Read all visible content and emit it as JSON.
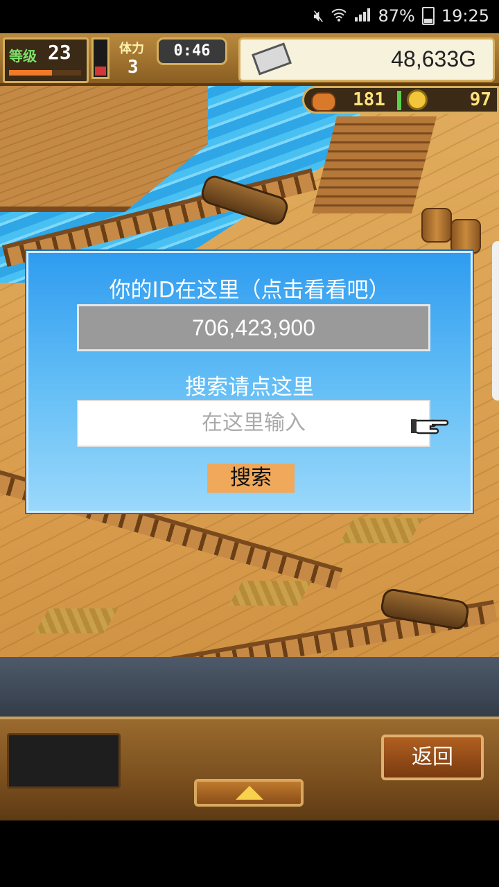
{
  "status_bar": {
    "battery": "87%",
    "time": "19:25"
  },
  "hud": {
    "level_label": "等级",
    "level_value": "23",
    "xp_fraction": 0.6,
    "stamina_label": "体力",
    "stamina_value": "3",
    "stamina_fraction": 0.25,
    "timer": "0:46",
    "gold": "48,633G",
    "resource_1": "181",
    "resource_2": "97"
  },
  "dialog": {
    "title": "你的ID在这里（点击看看吧）",
    "id_value": "706,423,900",
    "search_title": "搜索请点这里",
    "search_placeholder": "在这里输入",
    "search_button": "搜索"
  },
  "bottom_bar": {
    "back_label": "返回"
  }
}
